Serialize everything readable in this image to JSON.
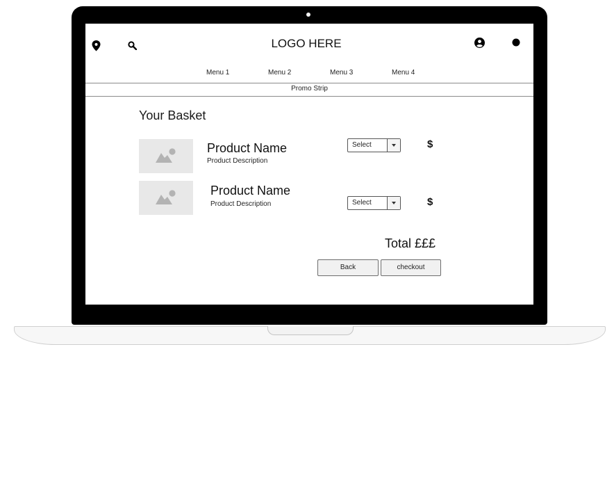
{
  "header": {
    "logo_text": "LOGO HERE",
    "icons": [
      "location-pin-icon",
      "search-icon",
      "account-icon",
      "dot-icon"
    ]
  },
  "nav": {
    "items": [
      {
        "label": "Menu 1"
      },
      {
        "label": "Menu 2"
      },
      {
        "label": "Menu 3"
      },
      {
        "label": "Menu 4"
      }
    ]
  },
  "promo": {
    "text": "Promo Strip"
  },
  "basket": {
    "title": "Your Basket",
    "items": [
      {
        "name": "Product Name",
        "description": "Product Description",
        "select_label": "Select",
        "price": "$",
        "image_icon": "image-placeholder-icon"
      },
      {
        "name": "Product Name",
        "description": "Product Description",
        "select_label": "Select",
        "price": "$",
        "image_icon": "image-placeholder-icon"
      }
    ],
    "total_text": "Total £££",
    "back_label": "Back",
    "checkout_label": "checkout"
  },
  "colors": {
    "device_frame": "#000000",
    "placeholder_bg": "#e8e8e8",
    "placeholder_icon": "#b3b3b3",
    "button_bg": "#f1f1f1"
  }
}
